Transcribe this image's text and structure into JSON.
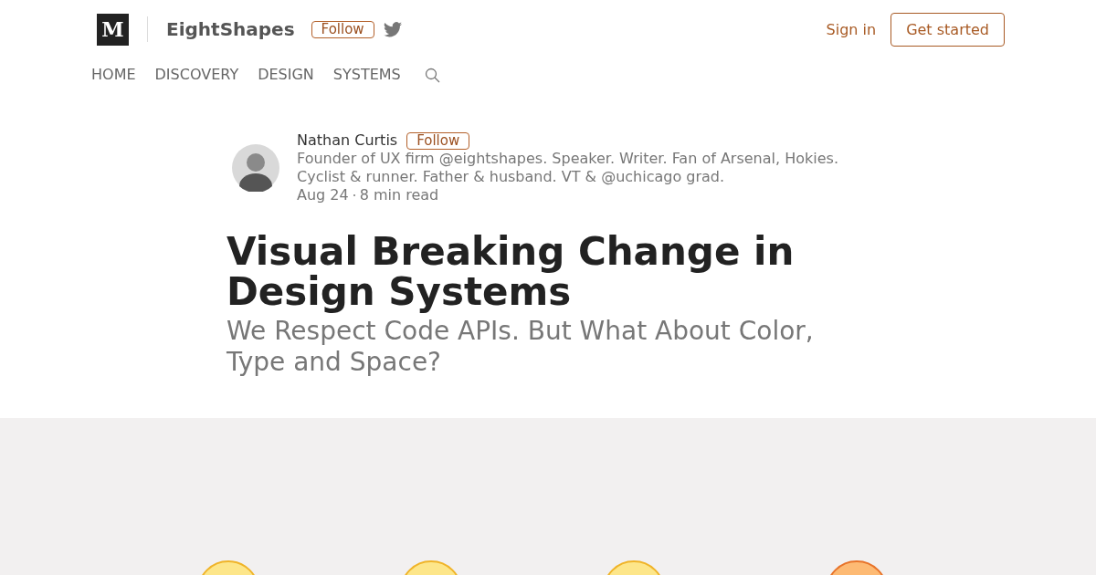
{
  "publication": {
    "logo": "M",
    "name": "EightShapes",
    "follow": "Follow"
  },
  "account": {
    "sign_in": "Sign in",
    "get_started": "Get started"
  },
  "nav": [
    {
      "label": "HOME"
    },
    {
      "label": "DISCOVERY"
    },
    {
      "label": "DESIGN"
    },
    {
      "label": "SYSTEMS"
    }
  ],
  "author": {
    "name": "Nathan Curtis",
    "follow": "Follow",
    "bio": "Founder of UX firm @eightshapes. Speaker. Writer. Fan of Arsenal, Hokies. Cyclist & runner. Father & husband. VT & @uchicago grad.",
    "date": "Aug 24",
    "read_time": "8 min read"
  },
  "article": {
    "title": "Visual Breaking Change in Design Systems",
    "subtitle": "We Respect Code APIs. But What About Color, Type and Space?"
  }
}
